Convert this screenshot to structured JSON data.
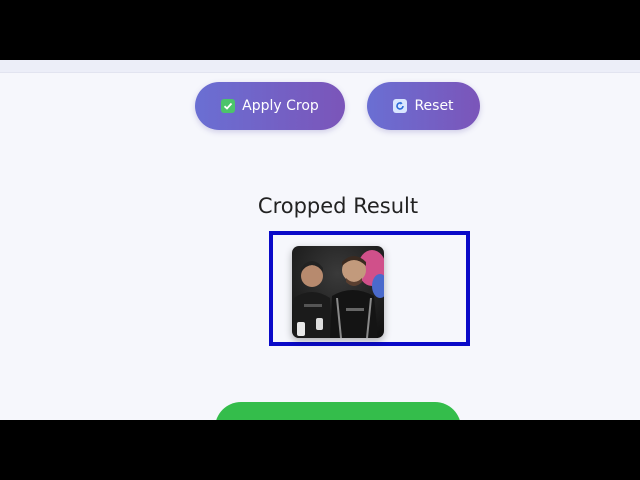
{
  "toolbar": {
    "apply_label": "Apply Crop",
    "reset_label": "Reset"
  },
  "result": {
    "title": "Cropped Result"
  },
  "icons": {
    "apply": "check-icon",
    "reset": "refresh-icon"
  },
  "colors": {
    "button_gradient_start": "#6a6fd3",
    "button_gradient_end": "#7b55b9",
    "frame_border": "#0a0ac8",
    "action_green": "#34bd4b",
    "page_bg": "#f6f7fc"
  }
}
